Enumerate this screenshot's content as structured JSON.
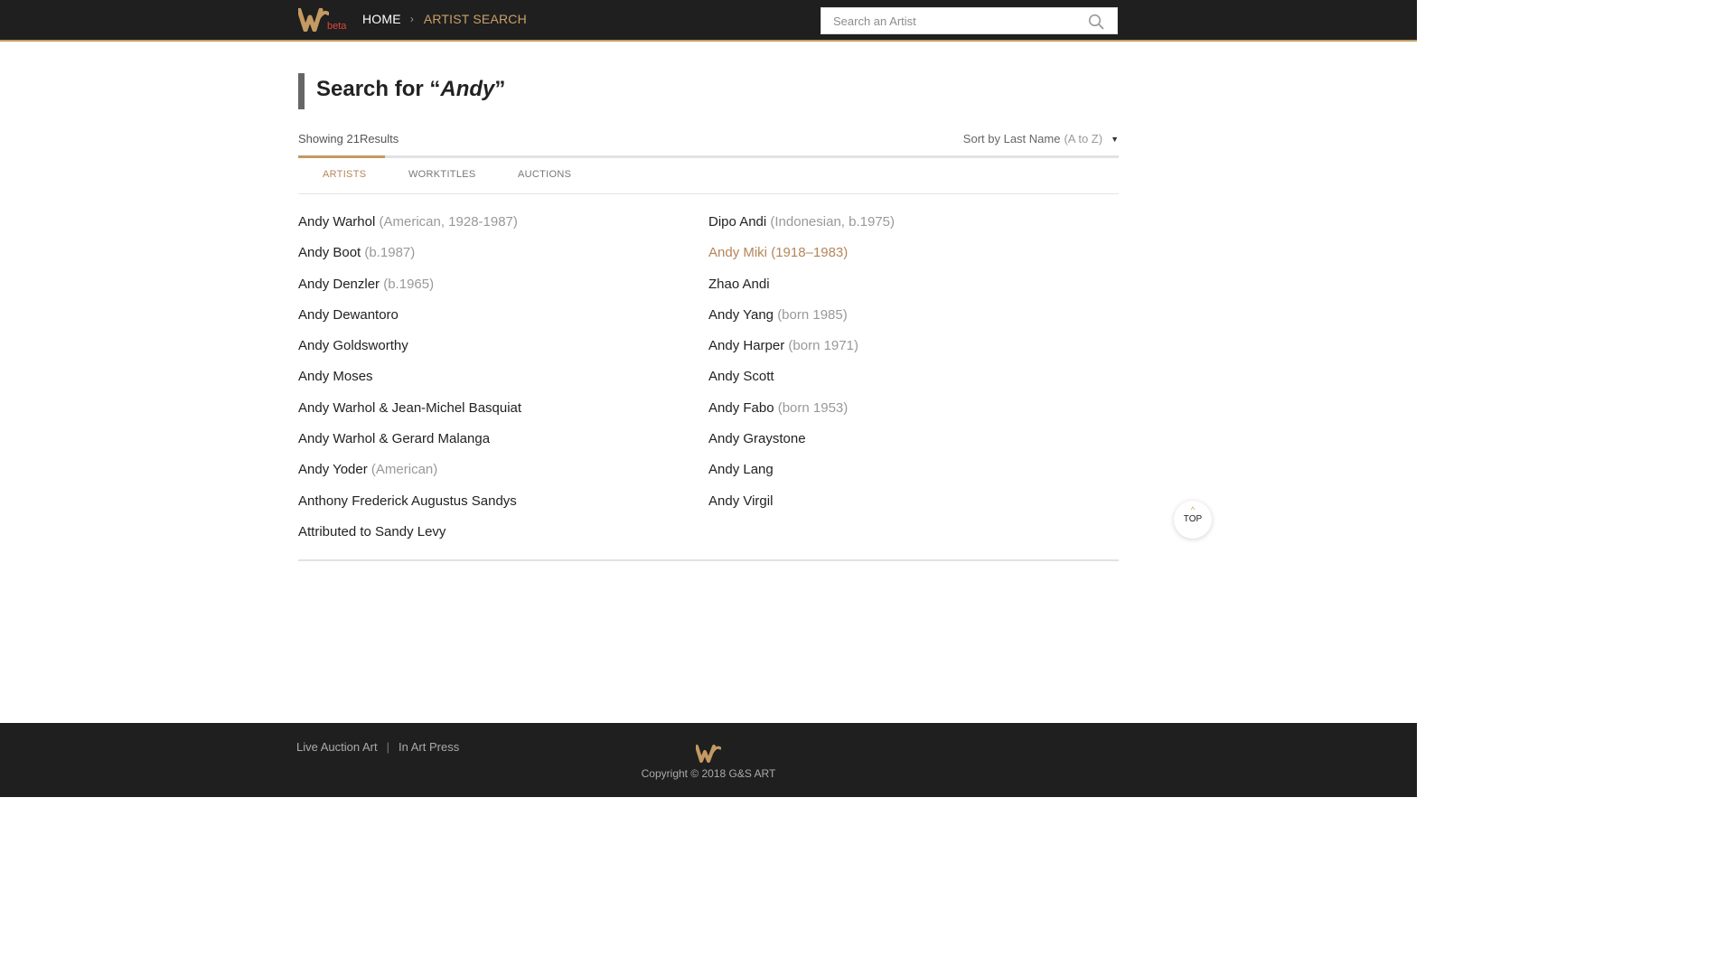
{
  "header": {
    "beta_label": "beta",
    "breadcrumb": {
      "home": "HOME",
      "separator": "›",
      "current": "ARTIST SEARCH"
    },
    "search": {
      "placeholder": "Search an Artist",
      "value": ""
    }
  },
  "main": {
    "title_prefix": "Search for “",
    "title_query": "Andy",
    "title_suffix": "”",
    "results_count": "Showing 21Results",
    "sort": {
      "label": "Sort by Last Name",
      "order": "(A to Z)",
      "caret": "▼"
    },
    "tabs": [
      {
        "label": "ARTISTS",
        "active": true
      },
      {
        "label": "WORKTITLES",
        "active": false
      },
      {
        "label": "AUCTIONS",
        "active": false
      }
    ],
    "left_column": [
      {
        "name": "Andy Warhol",
        "meta": "(American, 1928-1987)"
      },
      {
        "name": "Andy Boot",
        "meta": "(b.1987)"
      },
      {
        "name": "Andy Denzler",
        "meta": "(b.1965)"
      },
      {
        "name": "Andy Dewantoro",
        "meta": ""
      },
      {
        "name": "Andy Goldsworthy",
        "meta": ""
      },
      {
        "name": "Andy Moses",
        "meta": ""
      },
      {
        "name": "Andy Warhol & Jean-Michel Basquiat",
        "meta": ""
      },
      {
        "name": "Andy Warhol & Gerard Malanga",
        "meta": ""
      },
      {
        "name": "Andy Yoder",
        "meta": "(American)"
      },
      {
        "name": "Anthony Frederick Augustus Sandys",
        "meta": ""
      },
      {
        "name": "Attributed to Sandy Levy",
        "meta": ""
      }
    ],
    "right_column": [
      {
        "name": "Dipo Andi",
        "meta": "(Indonesian, b.1975)"
      },
      {
        "name": "Andy Miki",
        "meta": "(1918–1983)",
        "highlight": true
      },
      {
        "name": "Zhao Andi",
        "meta": ""
      },
      {
        "name": "Andy Yang",
        "meta": "(born 1985)"
      },
      {
        "name": "Andy Harper",
        "meta": "(born 1971)"
      },
      {
        "name": "Andy Scott",
        "meta": ""
      },
      {
        "name": "Andy Fabo",
        "meta": "(born 1953)"
      },
      {
        "name": "Andy Graystone",
        "meta": ""
      },
      {
        "name": "Andy Lang",
        "meta": ""
      },
      {
        "name": "Andy Virgil",
        "meta": ""
      }
    ],
    "top_button": {
      "arrow": "^",
      "label": "TOP"
    }
  },
  "footer": {
    "links": [
      "Live Auction Art",
      "In Art Press"
    ],
    "separator": "|",
    "copyright": "Copyright © 2018 G&S ART"
  },
  "colors": {
    "accent": "#c39a62",
    "link_highlight": "#b5865a",
    "beta": "#e0473a",
    "header_bg": "#1f1f1f"
  }
}
